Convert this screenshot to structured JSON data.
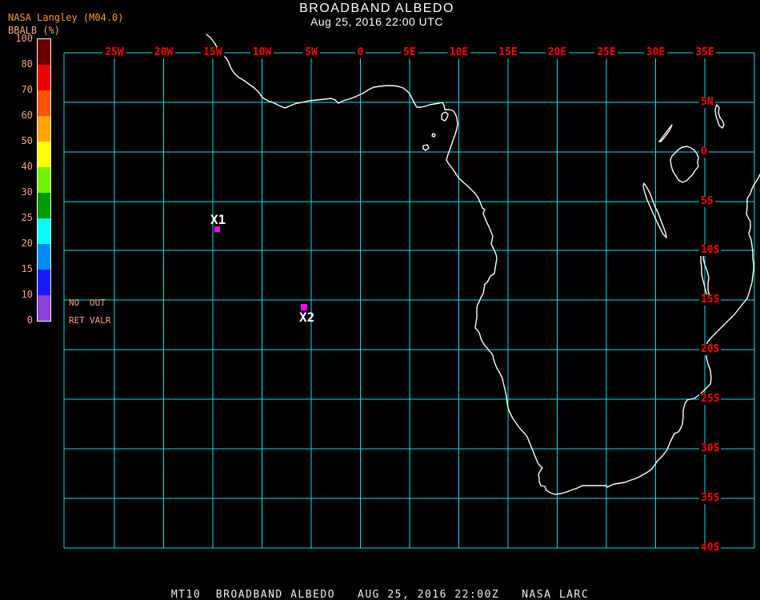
{
  "branding": {
    "source_line": "NASA Langley (M04.0)",
    "variable_label": "BBALB (%)"
  },
  "title": {
    "main": "BROADBAND ALBEDO",
    "datetime": "Aug 25, 2016 22:00 UTC"
  },
  "colorbar": {
    "tick_labels": [
      "100",
      "80",
      "70",
      "60",
      "50",
      "40",
      "30",
      "25",
      "20",
      "15",
      "10",
      "0"
    ],
    "segment_colors_top_to_bottom": [
      "#6E0000",
      "#EE0000",
      "#FF5500",
      "#FFA600",
      "#FFFF00",
      "#73F200",
      "#009900",
      "#00FFFF",
      "#008CFF",
      "#1A1AFF",
      "#8C3FD9"
    ],
    "flags": {
      "no": "NO",
      "out": "OUT",
      "ret": "RET",
      "valr": "VALR"
    }
  },
  "map": {
    "grid_color": "#00E5E5",
    "coastline_color": "#FFFFFF",
    "label_color": "#FF0000",
    "lon_labels": [
      "25W",
      "20W",
      "15W",
      "10W",
      "5W",
      "0",
      "5E",
      "10E",
      "15E",
      "20E",
      "25E",
      "30E",
      "35E"
    ],
    "lat_labels": [
      "5N",
      "0",
      "5S",
      "10S",
      "15S",
      "20S",
      "25S",
      "30S",
      "35S",
      "40S"
    ],
    "markers": [
      {
        "label": "X1",
        "color": "#FF00FF"
      },
      {
        "label": "X2",
        "color": "#FF00FF"
      }
    ]
  },
  "footer": {
    "text": "MT10  BROADBAND ALBEDO   AUG 25, 2016 22:00Z   NASA LARC"
  }
}
